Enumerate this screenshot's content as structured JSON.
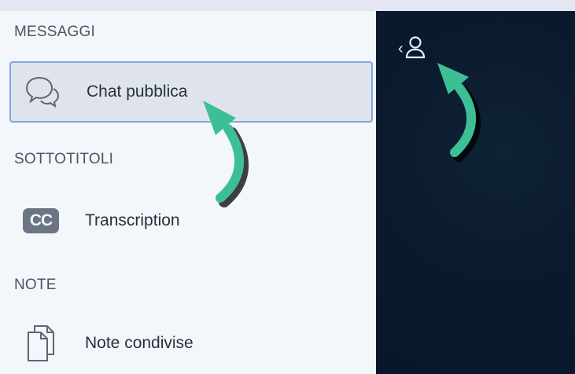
{
  "sections": {
    "messages": {
      "title": "MESSAGGI",
      "items": [
        {
          "label": "Chat pubblica",
          "icon": "chat-bubbles-icon",
          "active": true
        }
      ]
    },
    "captions": {
      "title": "SOTTOTITOLI",
      "items": [
        {
          "label": "Transcription",
          "icon": "closed-captions-icon",
          "badge": "CC"
        }
      ]
    },
    "notes": {
      "title": "NOTE",
      "items": [
        {
          "label": "Note condivise",
          "icon": "documents-icon"
        }
      ]
    }
  },
  "main": {
    "toggle_chevron": "‹",
    "toggle_icon": "user-icon"
  },
  "colors": {
    "sidebar_bg": "#f3f6fa",
    "active_item_bg": "#dfe4ec",
    "active_item_border": "#7fa8df",
    "main_bg": "#0b1b2e",
    "annotation_arrow": "#3dbf95"
  }
}
